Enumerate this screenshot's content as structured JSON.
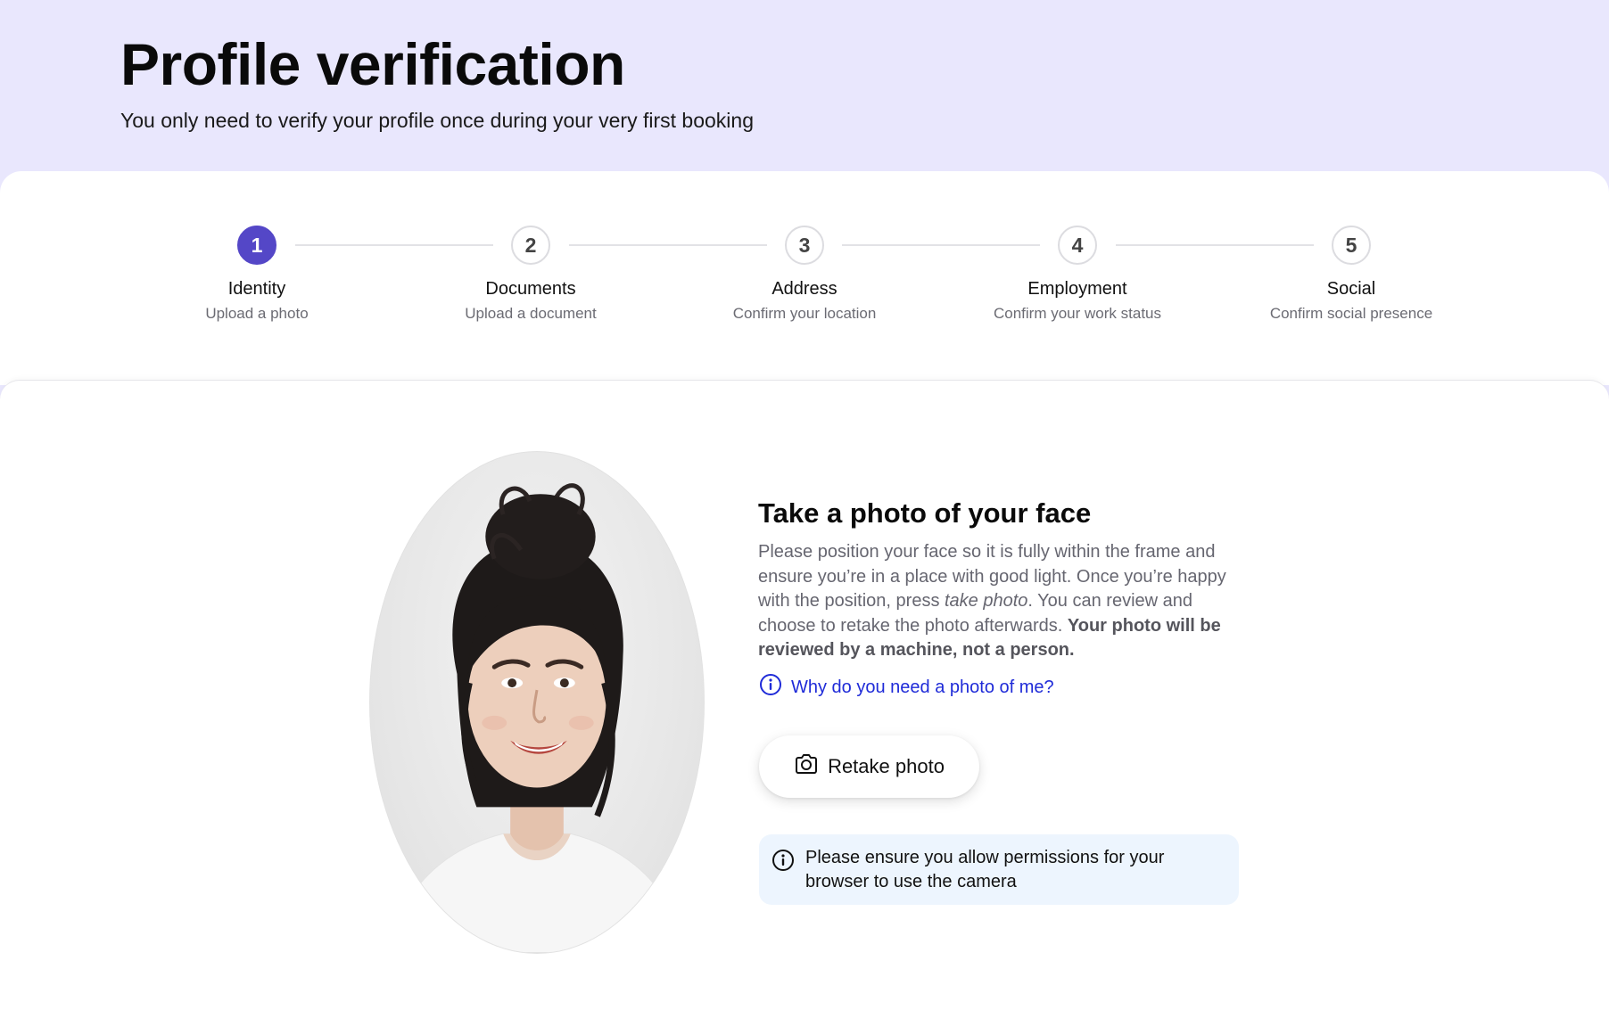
{
  "header": {
    "title": "Profile verification",
    "subtitle": "You only need to verify your profile once during your very first booking"
  },
  "stepper": {
    "active_step": 1,
    "steps": [
      {
        "number": "1",
        "title": "Identity",
        "subtitle": "Upload a photo"
      },
      {
        "number": "2",
        "title": "Documents",
        "subtitle": "Upload a document"
      },
      {
        "number": "3",
        "title": "Address",
        "subtitle": "Confirm your location"
      },
      {
        "number": "4",
        "title": "Employment",
        "subtitle": "Confirm your work status"
      },
      {
        "number": "5",
        "title": "Social",
        "subtitle": "Confirm social presence"
      }
    ]
  },
  "photo_section": {
    "title": "Take a photo of your face",
    "desc_part1": "Please position your face so it is fully within the frame and ensure you’re in a place with good light. Once you’re happy with the position, press ",
    "desc_italic": "take photo",
    "desc_part2": ". You can review and choose to retake the photo afterwards. ",
    "desc_bold": "Your photo will be reviewed by a machine, not a person.",
    "why_link": "Why do you need a photo of me?",
    "retake_label": "Retake photo",
    "notice": "Please ensure you allow permissions for your browser to use the camera"
  },
  "colors": {
    "accent": "#5447c7",
    "header_bg": "#e9e7fd",
    "link": "#1f2bd8",
    "notice_bg": "#edf5fe"
  },
  "icons": {
    "why_link": "info-circle-icon",
    "retake": "camera-icon",
    "notice": "info-circle-icon"
  }
}
